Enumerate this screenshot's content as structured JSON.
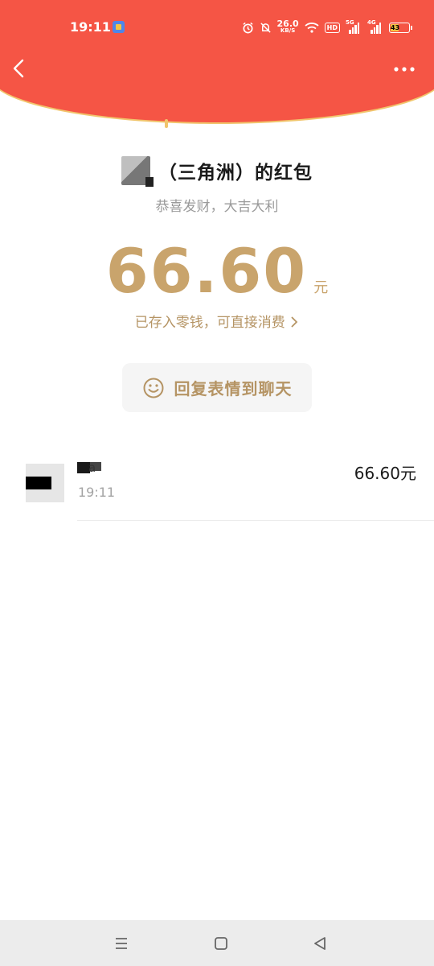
{
  "status_bar": {
    "time": "19:11",
    "net_speed_value": "26.0",
    "net_speed_unit": "KB/S",
    "hd_badge": "HD",
    "signal1_label": "5G",
    "signal2_label": "4G",
    "battery_level": "43"
  },
  "header": {
    "brand_color": "#F55545",
    "gold_accent": "#F1C56D"
  },
  "red_packet": {
    "title": "（三角洲）的红包",
    "greeting": "恭喜发财，大吉大利",
    "amount": "66.60",
    "amount_unit": "元",
    "wallet_note": "已存入零钱，可直接消费",
    "reply_button_label": "回复表情到聊天",
    "accent_color": "#C9A46C"
  },
  "records": [
    {
      "name": "a",
      "time": "19:11",
      "amount": "66.60元"
    }
  ]
}
